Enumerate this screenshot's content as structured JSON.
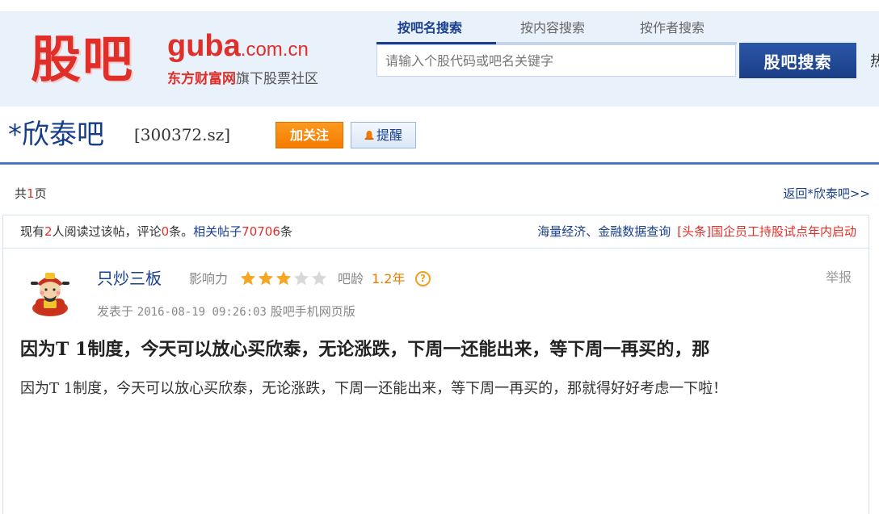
{
  "header": {
    "logo_main": "股吧",
    "logo_guba": "guba",
    "logo_domain": ".com.cn",
    "logo_brand": "东方财富网",
    "logo_tagline": "旗下股票社区",
    "tabs": [
      "按吧名搜索",
      "按内容搜索",
      "按作者搜索"
    ],
    "search_placeholder": "请输入个股代码或吧名关键字",
    "search_button": "股吧搜索",
    "cut_text": "热"
  },
  "bar": {
    "title": "*欣泰吧",
    "code": "[300372.sz]",
    "follow_label": "加关注",
    "remind_label": "提醒"
  },
  "pager": {
    "prefix": "共",
    "pages": "1",
    "suffix": "页",
    "back_label": "返回*欣泰吧>>"
  },
  "stats": {
    "t1": "现有",
    "readers": "2",
    "t2": "人阅读过该帖，评论",
    "comments": "0",
    "t3": "条。",
    "related_label": "相关帖子",
    "related_count": "70706",
    "t4": "条",
    "data_link": "海量经济、金融数据查询",
    "headline": "[头条]国企员工持股试点年内启动"
  },
  "post": {
    "author": "只炒三板",
    "influence_label": "影响力",
    "influence_stars": 3,
    "influence_max": 5,
    "age_label": "吧龄",
    "age_value": "1.2年",
    "help": "?",
    "report": "举报",
    "posted_prefix": "发表于",
    "posted_time": "2016-08-19 09:26:03",
    "posted_via": "股吧手机网页版",
    "title": "因为T 1制度，今天可以放心买欣泰，无论涨跌，下周一还能出来，等下周一再买的，那",
    "body": "因为T 1制度，今天可以放心买欣泰，无论涨跌，下周一还能出来，等下周一再买的，那就得好好考虑一下啦！"
  },
  "colors": {
    "brand_red": "#e02f29",
    "nav_blue": "#1a3f8f",
    "follow_orange": "#f47b00",
    "star_gold": "#f5a623",
    "star_empty": "#d8d8d8"
  }
}
